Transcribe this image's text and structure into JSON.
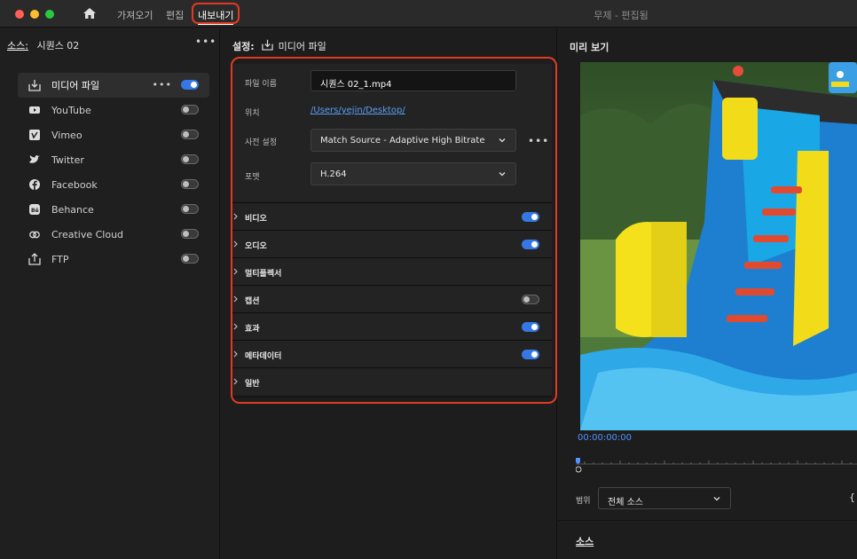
{
  "titlebar": {
    "nav": {
      "import": "가져오기",
      "edit": "편집",
      "export": "내보내기"
    },
    "window_title": "무제 - 편집됨"
  },
  "left": {
    "source_label": "소스:",
    "source_name": "시퀀스 02",
    "more": "•••",
    "destinations": [
      {
        "label": "미디어 파일",
        "icon": "media-file-icon",
        "on": true,
        "selected": true
      },
      {
        "label": "YouTube",
        "icon": "youtube-icon",
        "on": false
      },
      {
        "label": "Vimeo",
        "icon": "vimeo-icon",
        "on": false
      },
      {
        "label": "Twitter",
        "icon": "twitter-icon",
        "on": false
      },
      {
        "label": "Facebook",
        "icon": "facebook-icon",
        "on": false
      },
      {
        "label": "Behance",
        "icon": "behance-icon",
        "on": false
      },
      {
        "label": "Creative Cloud",
        "icon": "creative-cloud-icon",
        "on": false
      },
      {
        "label": "FTP",
        "icon": "ftp-icon",
        "on": false
      }
    ]
  },
  "settings": {
    "header_label": "설정:",
    "header_target": "미디어 파일",
    "file_name_label": "파일 이름",
    "file_name_value": "시퀀스 02_1.mp4",
    "location_label": "위치",
    "location_value": "/Users/yejin/Desktop/",
    "preset_label": "사전 설정",
    "preset_value": "Match Source - Adaptive High Bitrate",
    "format_label": "포맷",
    "format_value": "H.264",
    "more": "•••",
    "sections": [
      {
        "label": "비디오",
        "toggle": true,
        "on": true
      },
      {
        "label": "오디오",
        "toggle": true,
        "on": true
      },
      {
        "label": "멀티플렉서",
        "toggle": false
      },
      {
        "label": "캡션",
        "toggle": true,
        "on": false
      },
      {
        "label": "효과",
        "toggle": true,
        "on": true
      },
      {
        "label": "메타데이터",
        "toggle": true,
        "on": true
      },
      {
        "label": "일반",
        "toggle": false
      }
    ]
  },
  "preview": {
    "title": "미리 보기",
    "timecode": "00:00:00:00",
    "range_label": "범위",
    "range_value": "전체 소스",
    "brace": "{",
    "source_title": "소스"
  },
  "colors": {
    "accent": "#3578e5",
    "annotation": "#e23a22",
    "timecode": "#4f94ff",
    "link": "#5c9ef5"
  }
}
